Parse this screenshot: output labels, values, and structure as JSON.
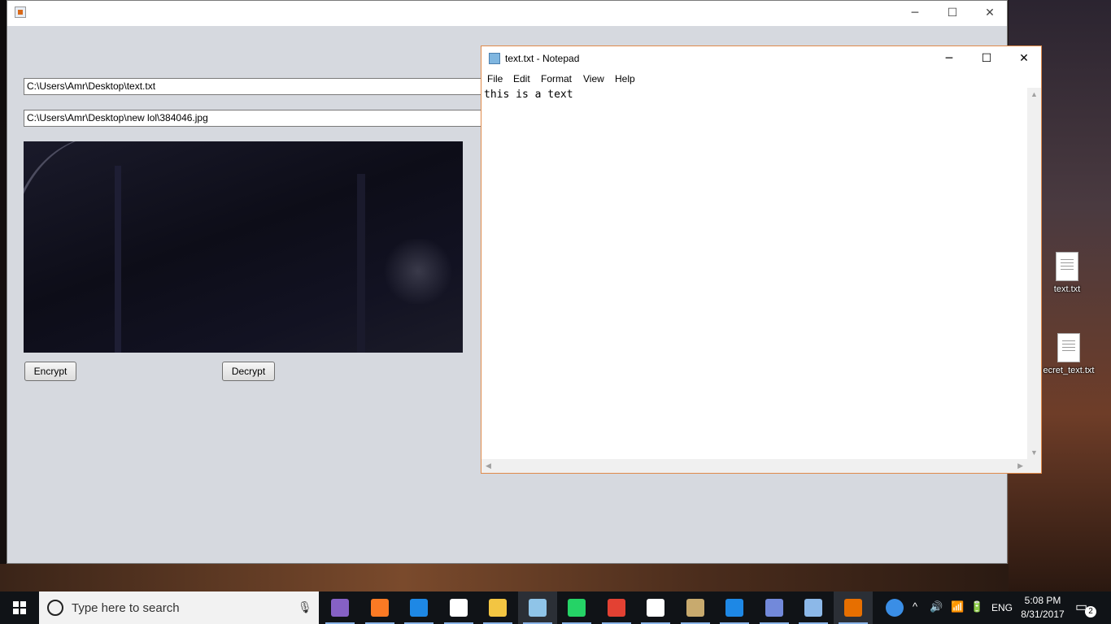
{
  "java_app": {
    "text_path": "C:\\Users\\Amr\\Desktop\\text.txt",
    "image_path": "C:\\Users\\Amr\\Desktop\\new lol\\384046.jpg",
    "encrypt_label": "Encrypt",
    "decrypt_label": "Decrypt",
    "minimize": "─",
    "maximize": "☐",
    "close": "✕"
  },
  "notepad": {
    "title": "text.txt - Notepad",
    "menu": [
      "File",
      "Edit",
      "Format",
      "View",
      "Help"
    ],
    "content": "this is a text",
    "minimize": "─",
    "maximize": "☐",
    "close": "✕"
  },
  "desktop": {
    "icons": [
      {
        "label": "text.txt"
      },
      {
        "label": "ecret_text.txt"
      }
    ]
  },
  "taskbar": {
    "search_placeholder": "Type here to search",
    "apps": [
      {
        "name": "visual-studio",
        "color": "#8661c5"
      },
      {
        "name": "xampp",
        "color": "#fb7a24"
      },
      {
        "name": "edge",
        "color": "#1e88e5"
      },
      {
        "name": "store",
        "color": "#ffffff"
      },
      {
        "name": "file-explorer",
        "color": "#f3c542"
      },
      {
        "name": "notepad",
        "color": "#8fc4e8"
      },
      {
        "name": "whatsapp",
        "color": "#25d366"
      },
      {
        "name": "chrome",
        "color": "#e34133"
      },
      {
        "name": "mail",
        "color": "#ffffff"
      },
      {
        "name": "league-of-legends",
        "color": "#c8aa6e"
      },
      {
        "name": "vs-code",
        "color": "#1e88e5"
      },
      {
        "name": "discord",
        "color": "#7289da"
      },
      {
        "name": "virtualbox",
        "color": "#8cb8e8"
      },
      {
        "name": "java",
        "color": "#e76f00"
      }
    ],
    "tray_lang": "ENG",
    "time": "5:08 PM",
    "date": "8/31/2017",
    "notifications": "2"
  }
}
